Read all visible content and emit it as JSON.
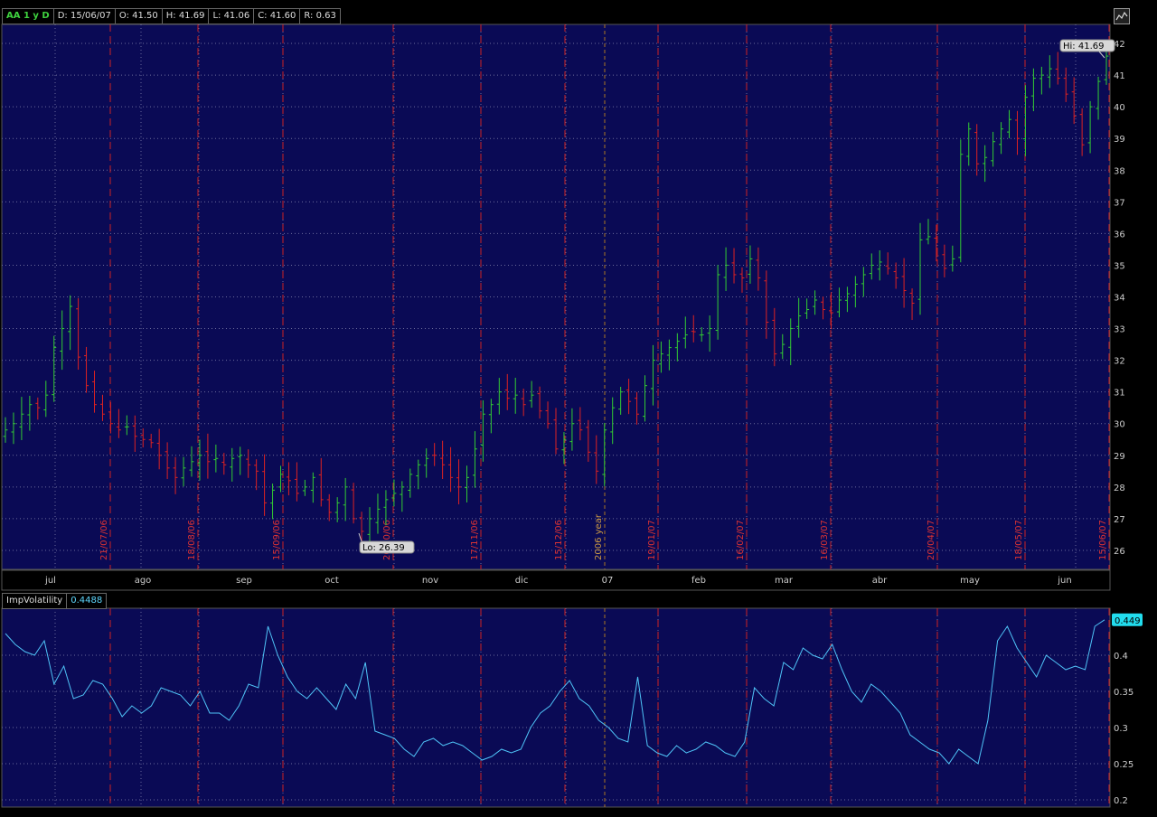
{
  "header": {
    "symbol": "AA 1 y D",
    "date": "D: 15/06/07",
    "open": "O: 41.50",
    "high": "H: 41.69",
    "low": "L: 41.06",
    "close": "C: 41.60",
    "range": "R: 0.63"
  },
  "indicator": {
    "name": "ImpVolatility",
    "value": "0.4488",
    "last_label": "0.449"
  },
  "markers": {
    "hi": "Hi: 41.69",
    "lo": "Lo: 26.39"
  },
  "colors": {
    "panel_bg": "#0a0a55",
    "up": "#33cc33",
    "down": "#dd2222",
    "separator": "#cc2222",
    "grid": "#6a6a9a",
    "line": "#4fc3f7",
    "text": "#cccccc"
  },
  "chart_data": [
    {
      "type": "ohlc",
      "title": "",
      "ylim": [
        25.4,
        42.6
      ],
      "y_ticks": [
        26,
        27,
        28,
        29,
        30,
        31,
        32,
        33,
        34,
        35,
        36,
        37,
        38,
        39,
        40,
        41,
        42
      ],
      "month_labels": [
        "jul",
        "ago",
        "sep",
        "oct",
        "nov",
        "dic",
        "07",
        "feb",
        "mar",
        "abr",
        "may",
        "jun"
      ],
      "separators": [
        {
          "label": "21/07/06"
        },
        {
          "label": "18/08/06"
        },
        {
          "label": "15/09/06"
        },
        {
          "label": "20/10/06"
        },
        {
          "label": "17/11/06"
        },
        {
          "label": "15/12/06"
        },
        {
          "label": "2006 year"
        },
        {
          "label": "19/01/07"
        },
        {
          "label": "16/02/07"
        },
        {
          "label": "16/03/07"
        },
        {
          "label": "20/04/07"
        },
        {
          "label": "18/05/07"
        },
        {
          "label": "15/06/07"
        }
      ],
      "close_path": [
        29.8,
        30.0,
        30.3,
        30.6,
        30.5,
        30.9,
        32.4,
        33.0,
        33.7,
        32.1,
        31.2,
        30.6,
        30.3,
        30.0,
        29.8,
        29.9,
        29.6,
        29.5,
        29.4,
        29.0,
        28.6,
        28.3,
        28.6,
        28.8,
        29.0,
        28.8,
        28.9,
        28.7,
        28.9,
        29.0,
        28.7,
        28.5,
        27.5,
        27.9,
        28.4,
        28.2,
        27.8,
        28.0,
        28.3,
        27.6,
        27.2,
        27.5,
        28.0,
        27.0,
        26.6,
        27.0,
        27.3,
        27.6,
        27.8,
        28.0,
        28.4,
        28.7,
        28.9,
        29.0,
        28.7,
        28.3,
        28.0,
        28.3,
        29.2,
        30.3,
        30.6,
        31.0,
        30.8,
        30.9,
        30.6,
        30.9,
        30.4,
        30.0,
        29.2,
        29.5,
        30.0,
        29.8,
        29.1,
        28.5,
        29.8,
        30.5,
        31.0,
        30.7,
        30.3,
        31.2,
        32.0,
        32.2,
        32.4,
        32.6,
        32.8,
        32.9,
        32.8,
        33.0,
        34.7,
        35.0,
        34.7,
        34.6,
        35.2,
        34.6,
        33.2,
        32.2,
        32.5,
        33.0,
        33.4,
        33.6,
        33.9,
        33.6,
        33.5,
        33.9,
        34.1,
        34.4,
        34.7,
        35.0,
        35.1,
        34.9,
        34.6,
        34.2,
        33.8,
        35.8,
        35.9,
        35.3,
        34.9,
        35.2,
        38.5,
        39.3,
        38.2,
        38.4,
        38.9,
        39.3,
        39.6,
        39.0,
        40.3,
        40.9,
        41.0,
        41.2,
        40.9,
        40.4,
        39.7,
        38.8,
        40.0,
        40.8,
        41.6
      ]
    },
    {
      "type": "line",
      "title": "",
      "series_name": "ImpVolatility",
      "ylim": [
        0.19,
        0.465
      ],
      "y_ticks": [
        0.2,
        0.25,
        0.3,
        0.35,
        0.4
      ],
      "values": [
        0.43,
        0.415,
        0.405,
        0.4,
        0.42,
        0.36,
        0.385,
        0.34,
        0.345,
        0.365,
        0.36,
        0.34,
        0.315,
        0.33,
        0.32,
        0.33,
        0.355,
        0.35,
        0.345,
        0.33,
        0.35,
        0.32,
        0.32,
        0.31,
        0.33,
        0.36,
        0.355,
        0.44,
        0.4,
        0.37,
        0.35,
        0.34,
        0.355,
        0.34,
        0.325,
        0.36,
        0.34,
        0.39,
        0.295,
        0.29,
        0.285,
        0.27,
        0.26,
        0.28,
        0.285,
        0.275,
        0.28,
        0.275,
        0.265,
        0.255,
        0.26,
        0.27,
        0.265,
        0.27,
        0.3,
        0.32,
        0.33,
        0.35,
        0.365,
        0.34,
        0.33,
        0.31,
        0.3,
        0.285,
        0.28,
        0.37,
        0.275,
        0.265,
        0.26,
        0.275,
        0.265,
        0.27,
        0.28,
        0.275,
        0.265,
        0.26,
        0.28,
        0.355,
        0.34,
        0.33,
        0.39,
        0.38,
        0.41,
        0.4,
        0.395,
        0.415,
        0.38,
        0.35,
        0.335,
        0.36,
        0.35,
        0.335,
        0.32,
        0.29,
        0.28,
        0.27,
        0.265,
        0.25,
        0.27,
        0.26,
        0.25,
        0.31,
        0.42,
        0.44,
        0.41,
        0.39,
        0.37,
        0.4,
        0.39,
        0.38,
        0.385,
        0.38,
        0.44,
        0.449
      ]
    }
  ]
}
